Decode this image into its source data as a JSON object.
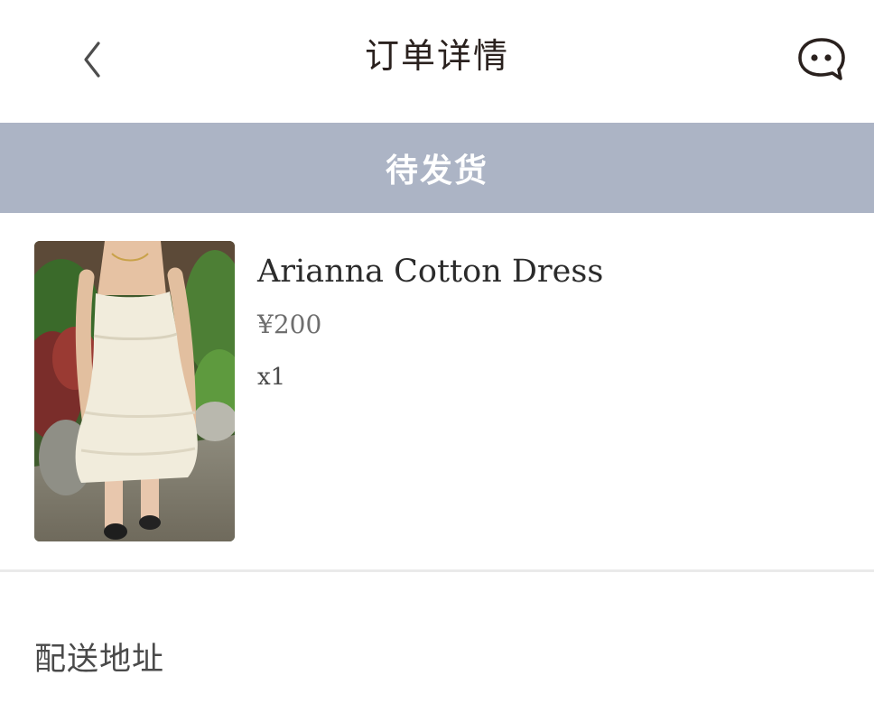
{
  "header": {
    "title": "订单详情",
    "back_icon": "chevron-left-icon",
    "chat_icon": "chat-bubble-icon"
  },
  "order": {
    "status": "待发货",
    "status_color": "#acb4c5"
  },
  "product": {
    "name": "Arianna Cotton Dress",
    "price": "¥200",
    "quantity": "x1",
    "image": "dress-photo"
  },
  "sections": {
    "shipping_address_title": "配送地址"
  }
}
